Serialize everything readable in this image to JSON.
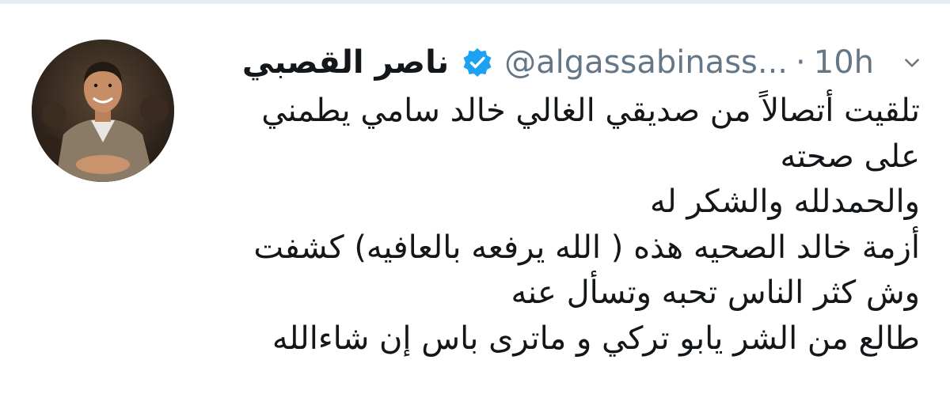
{
  "tweet": {
    "author": {
      "display_name": "ناصر القصبي",
      "handle": "@algassabinass...",
      "verified": true,
      "verified_color": "#1da1f2"
    },
    "separator": "·",
    "timestamp": "10h",
    "menu_icon": "chevron-down-icon",
    "lines": [
      "تلقيت أتصالاً من صديقي الغالي خالد سامي يطمني",
      "على صحته",
      "والحمدلله والشكر له",
      "أزمة خالد الصحيه هذه ( الله يرفعه بالعافيه) كشفت",
      "وش كثر الناس تحبه وتسأل عنه",
      "طالع من الشر يابو تركي و ماترى باس إن شاءالله"
    ]
  },
  "colors": {
    "text": "#14171a",
    "secondary": "#657786",
    "divider": "#e6ecf0",
    "background": "#ffffff"
  }
}
